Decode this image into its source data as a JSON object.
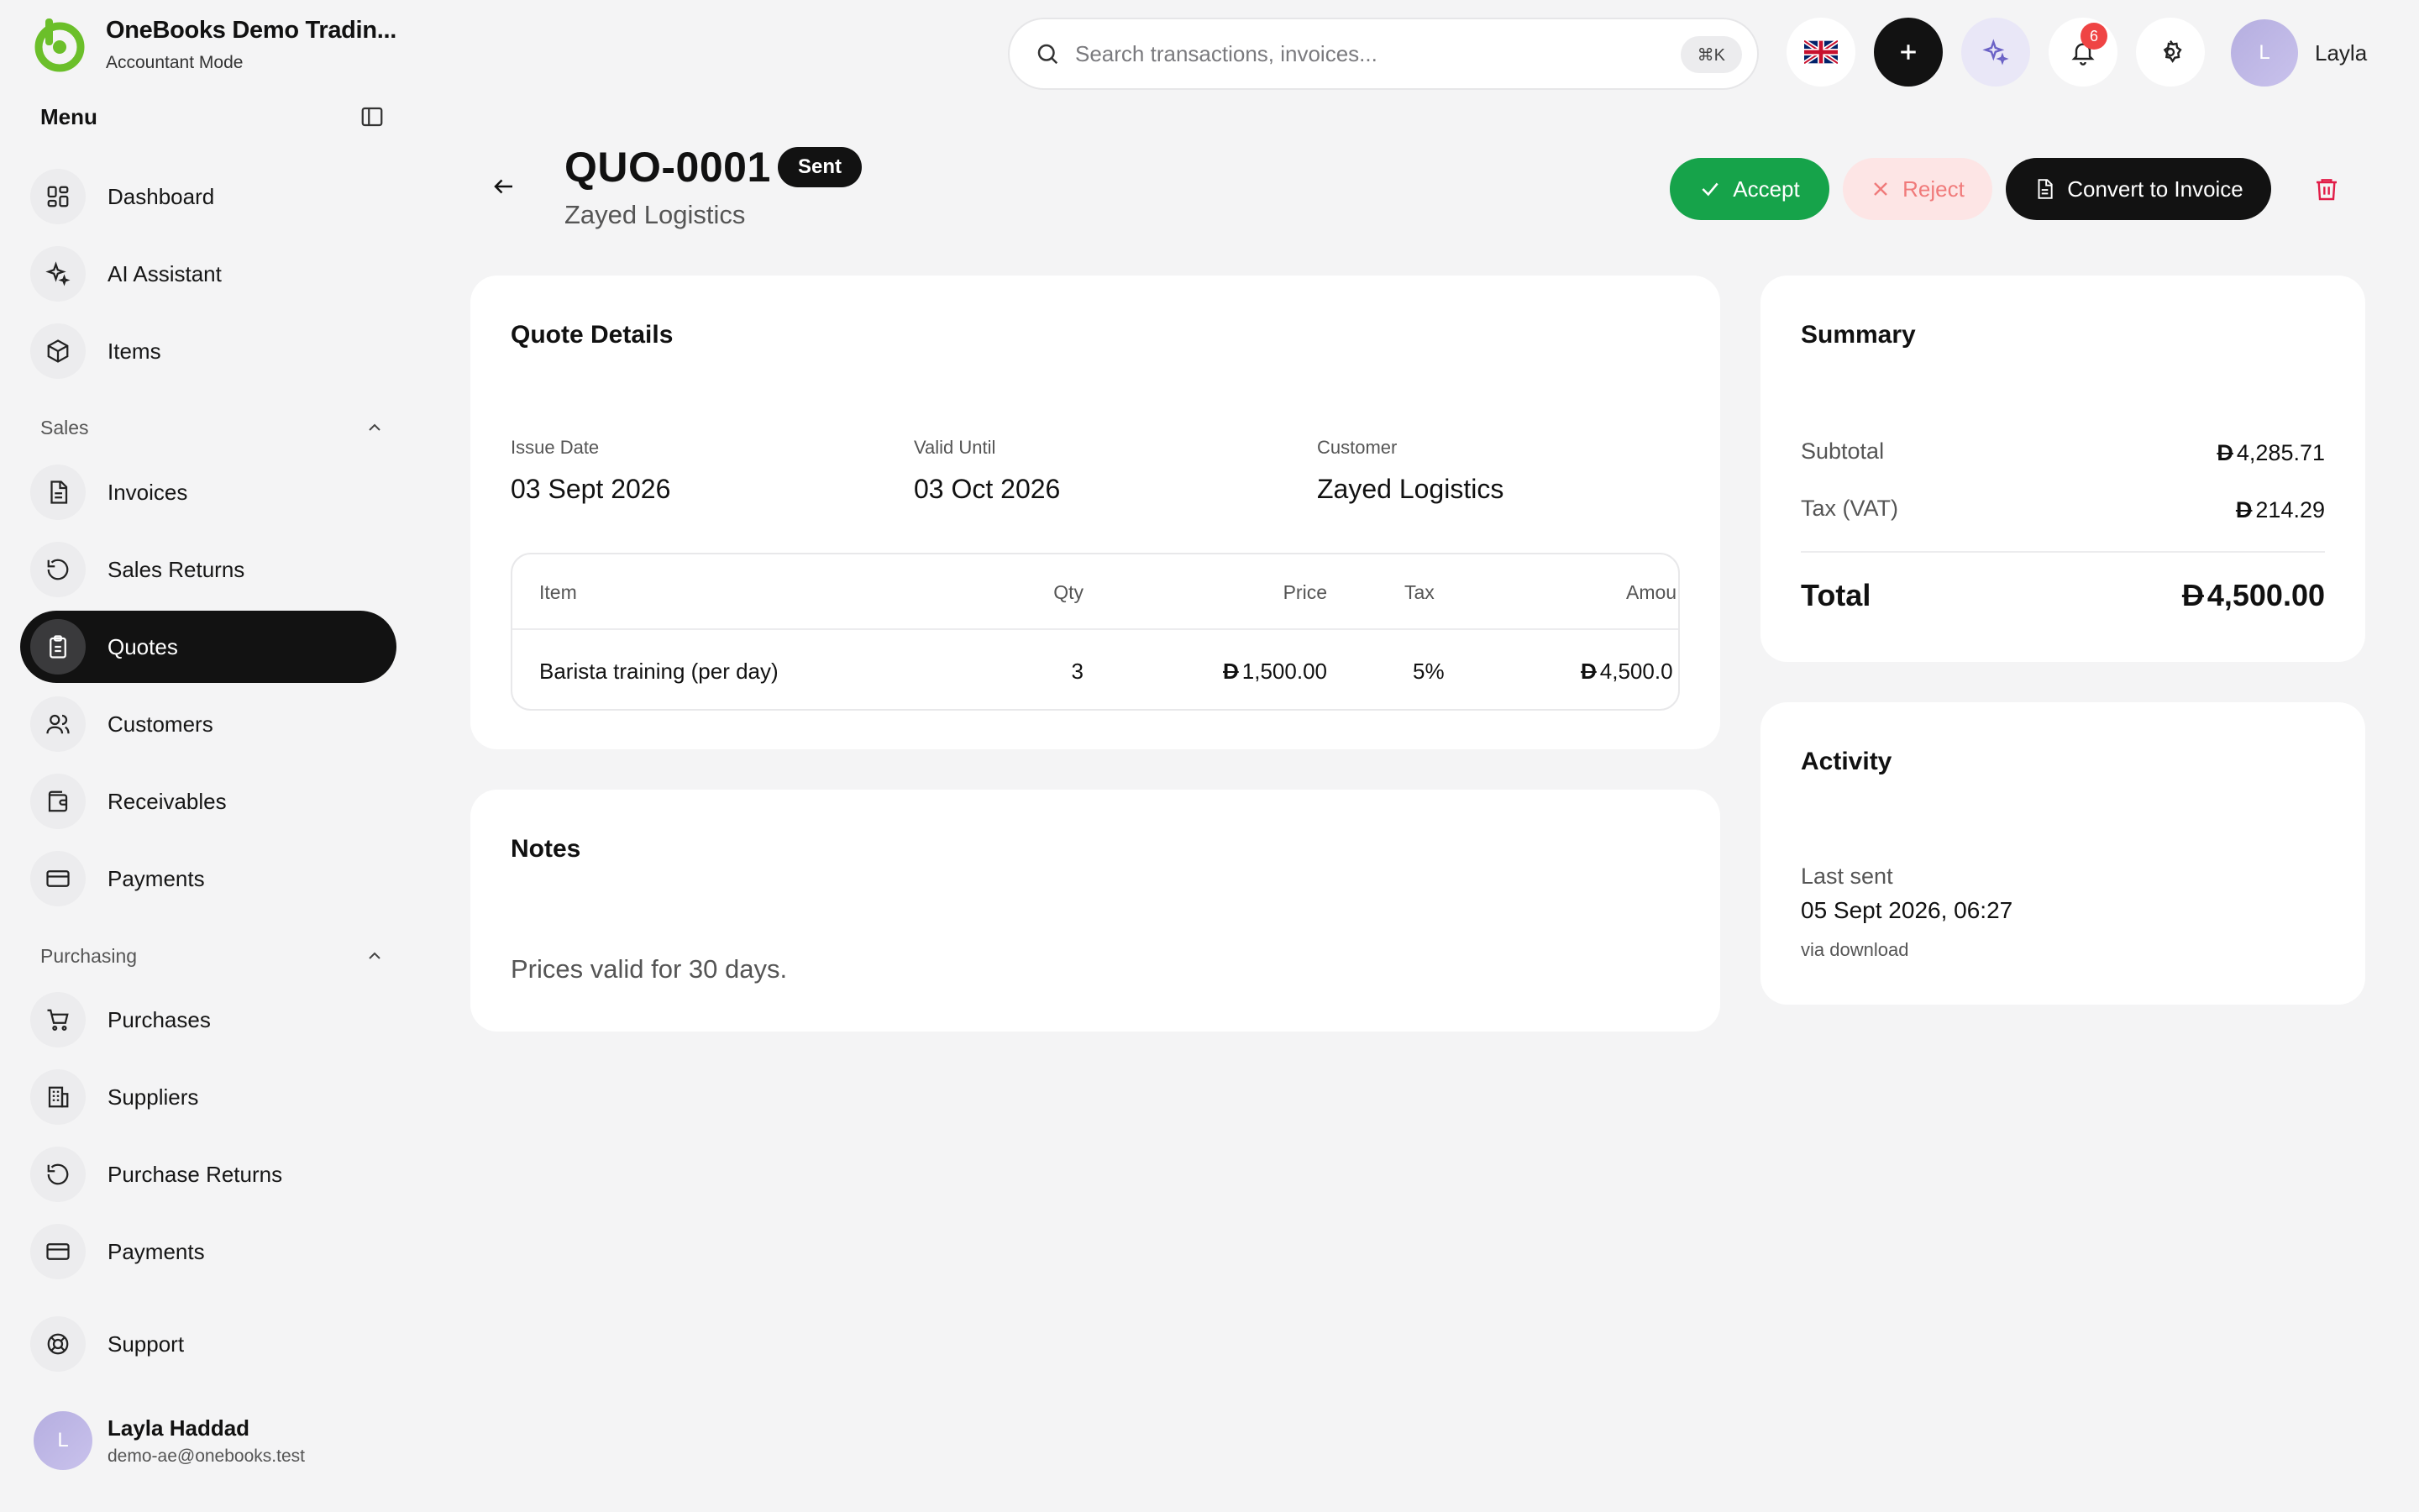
{
  "brand": {
    "name": "OneBooks Demo Tradin...",
    "mode": "Accountant Mode",
    "logo_color": "#6bbf2a"
  },
  "sidebar": {
    "menu_title": "Menu",
    "items": [
      {
        "label": "Dashboard",
        "icon": "dashboard-icon"
      },
      {
        "label": "AI Assistant",
        "icon": "sparkles-icon"
      },
      {
        "label": "Items",
        "icon": "box-icon"
      }
    ],
    "sales": {
      "label": "Sales",
      "items": [
        {
          "label": "Invoices",
          "icon": "document-icon"
        },
        {
          "label": "Sales Returns",
          "icon": "rotate-icon"
        },
        {
          "label": "Quotes",
          "icon": "clipboard-icon",
          "active": true
        },
        {
          "label": "Customers",
          "icon": "users-icon"
        },
        {
          "label": "Receivables",
          "icon": "wallet-icon"
        },
        {
          "label": "Payments",
          "icon": "card-icon"
        }
      ]
    },
    "purchasing": {
      "label": "Purchasing",
      "items": [
        {
          "label": "Purchases",
          "icon": "cart-icon"
        },
        {
          "label": "Suppliers",
          "icon": "building-icon"
        },
        {
          "label": "Purchase Returns",
          "icon": "rotate-icon"
        },
        {
          "label": "Payments",
          "icon": "card-icon"
        }
      ]
    },
    "support": {
      "label": "Support",
      "icon": "lifebuoy-icon"
    },
    "user": {
      "initial": "L",
      "name": "Layla Haddad",
      "email": "demo-ae@onebooks.test"
    }
  },
  "topbar": {
    "search_placeholder": "Search transactions, invoices...",
    "shortcut": "⌘K",
    "notification_count": "6",
    "user_initial": "L",
    "user_name": "Layla"
  },
  "quote": {
    "number": "QUO-0001",
    "status": "Sent",
    "customer": "Zayed Logistics",
    "actions": {
      "accept": "Accept",
      "reject": "Reject",
      "convert": "Convert to Invoice"
    },
    "details": {
      "title": "Quote Details",
      "issue_date_label": "Issue Date",
      "issue_date": "03 Sept 2026",
      "valid_until_label": "Valid Until",
      "valid_until": "03 Oct 2026",
      "customer_label": "Customer",
      "customer": "Zayed Logistics"
    },
    "table": {
      "headers": {
        "item": "Item",
        "qty": "Qty",
        "price": "Price",
        "tax": "Tax",
        "amount": "Amou"
      },
      "rows": [
        {
          "item": "Barista training (per day)",
          "qty": "3",
          "price": "1,500.00",
          "tax": "5%",
          "amount": "4,500.0"
        }
      ]
    },
    "notes": {
      "title": "Notes",
      "text": "Prices valid for 30 days."
    },
    "summary": {
      "title": "Summary",
      "currency_symbol": "D",
      "subtotal_label": "Subtotal",
      "subtotal": "4,285.71",
      "tax_label": "Tax (VAT)",
      "tax": "214.29",
      "total_label": "Total",
      "total": "4,500.00"
    },
    "activity": {
      "title": "Activity",
      "last_sent_label": "Last sent",
      "last_sent": "05 Sept 2026, 06:27",
      "via": "via download"
    }
  },
  "colors": {
    "accept": "#16a34a",
    "reject_bg": "#fde5e5",
    "reject_text": "#f07a7a",
    "dark": "#121212",
    "badge": "#ef4444",
    "delete": "#e11d48"
  }
}
